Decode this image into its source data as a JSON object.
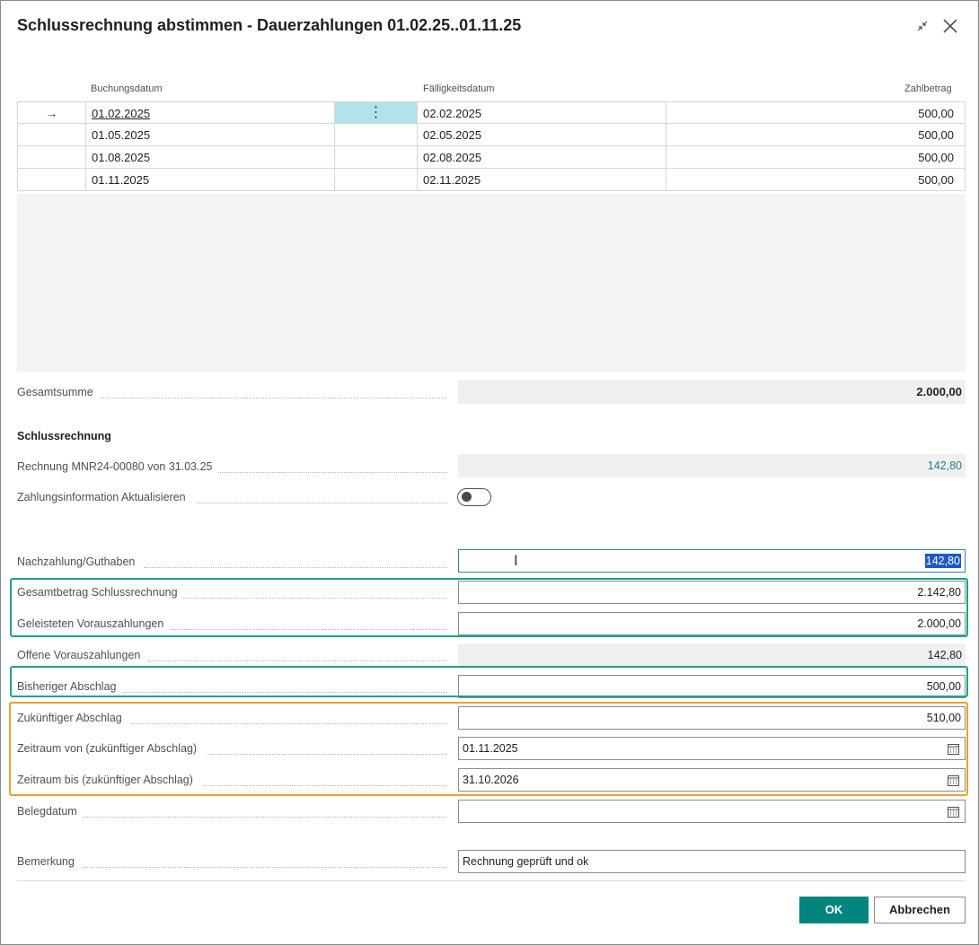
{
  "dialog": {
    "title": "Schlussrechnung abstimmen - Dauerzahlungen 01.02.25..01.11.25",
    "icons": {
      "collapse": "collapse-arrows-icon",
      "close": "close-x-icon"
    }
  },
  "grid": {
    "columns": {
      "buchungsdatum": "Buchungsdatum",
      "faelligkeitsdatum": "Fälligkeitsdatum",
      "zahlbetrag": "Zahlbetrag"
    },
    "current_row_marker": "→",
    "row_menu_glyph": "⋮",
    "rows": [
      {
        "buchungsdatum": "01.02.2025",
        "faelligkeitsdatum": "02.02.2025",
        "zahlbetrag": "500,00"
      },
      {
        "buchungsdatum": "01.05.2025",
        "faelligkeitsdatum": "02.05.2025",
        "zahlbetrag": "500,00"
      },
      {
        "buchungsdatum": "01.08.2025",
        "faelligkeitsdatum": "02.08.2025",
        "zahlbetrag": "500,00"
      },
      {
        "buchungsdatum": "01.11.2025",
        "faelligkeitsdatum": "02.11.2025",
        "zahlbetrag": "500,00"
      }
    ]
  },
  "total": {
    "label": "Gesamtsumme",
    "value": "2.000,00"
  },
  "schlussrechnung": {
    "heading": "Schlussrechnung",
    "rechnung": {
      "label": "Rechnung MNR24-00080 von 31.03.25",
      "value": "142,80"
    },
    "zahlungsinfo": {
      "label": "Zahlungsinformation Aktualisieren",
      "value": "off"
    }
  },
  "fields": {
    "nachzahlung": {
      "label": "Nachzahlung/Guthaben",
      "value": "142,80"
    },
    "gesamtbetrag": {
      "label": "Gesamtbetrag Schlussrechnung",
      "value": "2.142,80"
    },
    "geleistet": {
      "label": "Geleisteten Vorauszahlungen",
      "value": "2.000,00"
    },
    "offen": {
      "label": "Offene Vorauszahlungen",
      "value": "142,80"
    },
    "bisheriger": {
      "label": "Bisheriger Abschlag",
      "value": "500,00"
    },
    "zukuenftiger": {
      "label": "Zukünftiger Abschlag",
      "value": "510,00"
    },
    "zeitraum_von": {
      "label": "Zeitraum von (zukünftiger Abschlag)",
      "value": "01.11.2025"
    },
    "zeitraum_bis": {
      "label": "Zeitraum bis (zukünftiger Abschlag)",
      "value": "31.10.2026"
    },
    "belegdatum": {
      "label": "Belegdatum",
      "value": ""
    },
    "bemerkung": {
      "label": "Bemerkung",
      "value": "Rechnung geprüft und ok"
    }
  },
  "buttons": {
    "ok": "OK",
    "cancel": "Abbrechen"
  },
  "colors": {
    "accent": "#00867c",
    "highlight_teal": "#1ba28f",
    "highlight_orange": "#eaa32a",
    "link_value": "#1a7f8e"
  }
}
